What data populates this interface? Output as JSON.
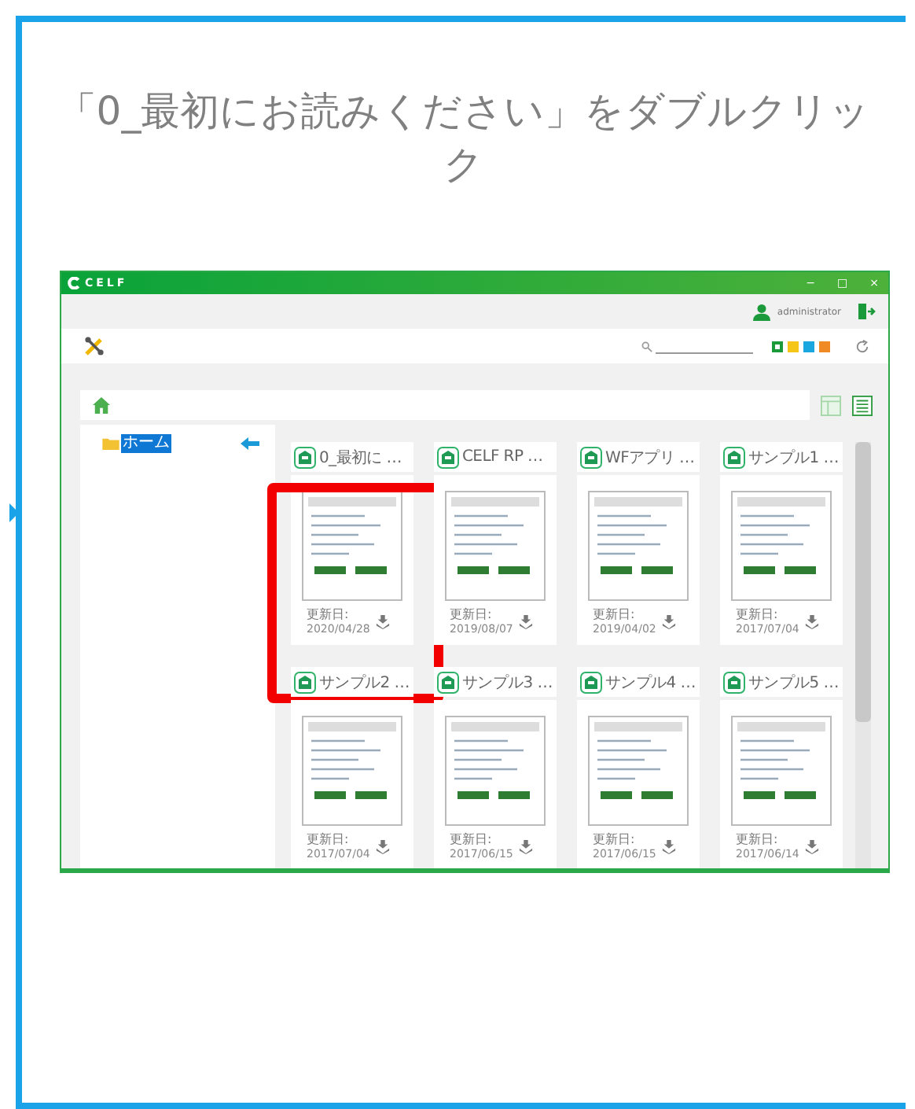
{
  "caption": "「0_最初にお読みください」をダブルクリック",
  "app": {
    "title": "CELF",
    "window_controls": [
      "−",
      "□",
      "×"
    ],
    "user": "administrator",
    "color_filters": [
      {
        "color": "#1a9a3a",
        "selected": true
      },
      {
        "color": "#f5c518",
        "selected": false
      },
      {
        "color": "#1aa7e0",
        "selected": false
      },
      {
        "color": "#f08a24",
        "selected": false
      }
    ],
    "sidebar": {
      "items": [
        {
          "label": "ホーム",
          "selected": true
        }
      ]
    },
    "cards": [
      {
        "title": "0_最初に …",
        "updated_label": "更新日:",
        "date": "2020/04/28",
        "highlighted": true
      },
      {
        "title": "CELF RP …",
        "updated_label": "更新日:",
        "date": "2019/08/07",
        "highlighted": false
      },
      {
        "title": "WFアプリ …",
        "updated_label": "更新日:",
        "date": "2019/04/02",
        "highlighted": false
      },
      {
        "title": "サンプル1 …",
        "updated_label": "更新日:",
        "date": "2017/07/04",
        "highlighted": false
      },
      {
        "title": "サンプル2 …",
        "updated_label": "更新日:",
        "date": "2017/07/04",
        "highlighted": false
      },
      {
        "title": "サンプル3 …",
        "updated_label": "更新日:",
        "date": "2017/06/15",
        "highlighted": false
      },
      {
        "title": "サンプル4 …",
        "updated_label": "更新日:",
        "date": "2017/06/15",
        "highlighted": false
      },
      {
        "title": "サンプル5 …",
        "updated_label": "更新日:",
        "date": "2017/06/14",
        "highlighted": false
      }
    ]
  }
}
